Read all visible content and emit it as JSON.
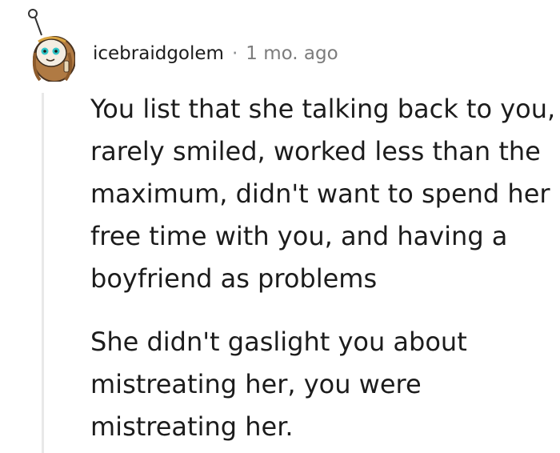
{
  "comment": {
    "username": "icebraidgolem",
    "separator": "·",
    "timestamp": "1 mo. ago",
    "avatar_icon": "snoo-avatar-icon",
    "paragraphs": [
      "You list that she talking back to you,\nrarely smiled, worked less than the\nmaximum, didn't want to spend her\nfree time with you, and having a\nboyfriend as problems",
      "She didn't gaslight you about\nmistreating her, you were\nmistreating her."
    ]
  }
}
